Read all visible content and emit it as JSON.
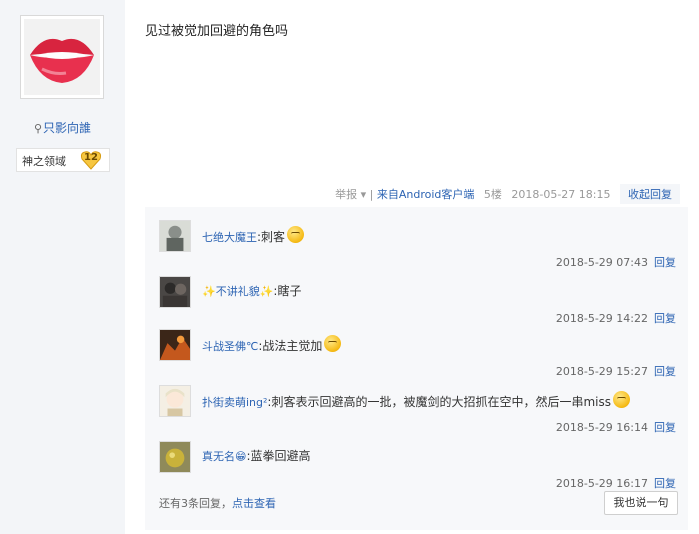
{
  "author": {
    "name": "只影向誰",
    "badge_name": "神之领域",
    "badge_level": "12"
  },
  "post": {
    "content": "见过被觉加回避的角色吗",
    "report": "举报 ▾",
    "separator": "|",
    "source": "来自Android客户端",
    "floor": "5楼",
    "time": "2018-05-27 18:15",
    "collapse_label": "收起回复"
  },
  "replies": [
    {
      "user": "七绝大魔王",
      "sep": ":",
      "text": "刺客",
      "has_emoji": true,
      "time": "2018-5-29 07:43",
      "reply_label": "回复"
    },
    {
      "user": "✨不讲礼貌✨",
      "sep": ":",
      "text": "瞎子",
      "has_emoji": false,
      "time": "2018-5-29 14:22",
      "reply_label": "回复"
    },
    {
      "user": "斗战圣佛℃",
      "sep": ":",
      "text": "战法主觉加",
      "has_emoji": true,
      "time": "2018-5-29 15:27",
      "reply_label": "回复"
    },
    {
      "user": "扑街卖萌ing²",
      "sep": ":",
      "text": "刺客表示回避高的一批，被魔剑的大招抓在空中，然后一串miss",
      "has_emoji": true,
      "time": "2018-5-29 16:14",
      "reply_label": "回复"
    },
    {
      "user": "真无名😁",
      "sep": ":",
      "text": "蓝拳回避高",
      "has_emoji": false,
      "time": "2018-5-29 16:17",
      "reply_label": "回复"
    }
  ],
  "footer": {
    "more_prefix": "还有3条回复，",
    "more_link": "点击查看",
    "say_button": "我也说一句"
  }
}
